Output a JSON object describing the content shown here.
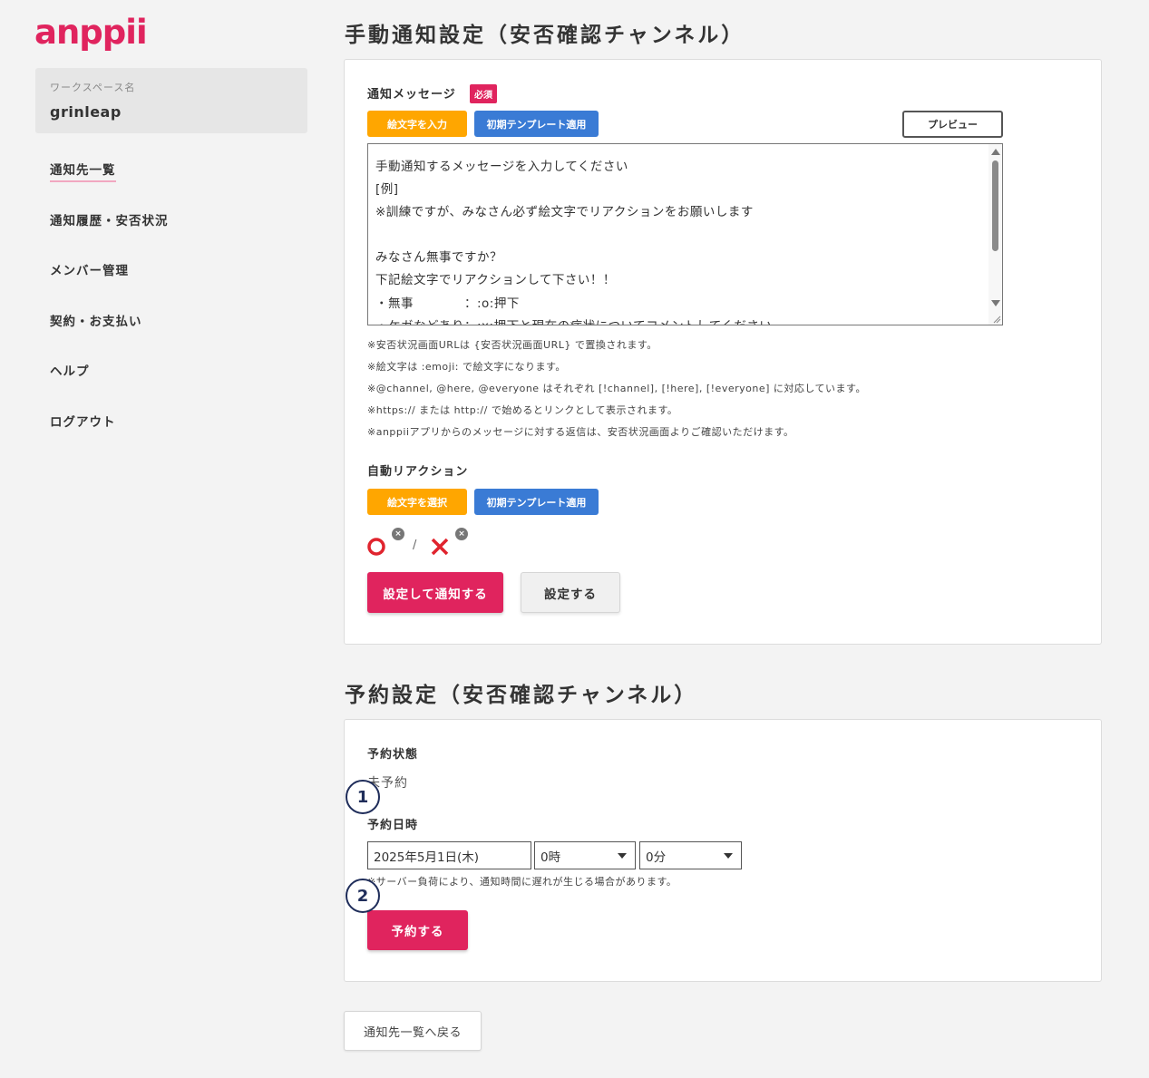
{
  "app": {
    "logo": "anppii",
    "brand_color": "#e0245e"
  },
  "workspace": {
    "label": "ワークスペース名",
    "name": "grinleap"
  },
  "nav": {
    "items": [
      {
        "label": "通知先一覧",
        "active": true
      },
      {
        "label": "通知履歴・安否状況"
      },
      {
        "label": "メンバー管理"
      },
      {
        "label": "契約・お支払い"
      },
      {
        "label": "ヘルプ"
      },
      {
        "label": "ログアウト"
      }
    ]
  },
  "manual": {
    "title": "手動通知設定（安否確認チャンネル）",
    "message_label": "通知メッセージ",
    "required_badge": "必須",
    "emoji_input_button": "絵文字を入力",
    "template_button": "初期テンプレート適用",
    "preview_button": "プレビュー",
    "message_lines": [
      "手動通知するメッセージを入力してください",
      "[例]",
      "※訓練ですが、みなさん必ず絵文字でリアクションをお願いします",
      "",
      "みなさん無事ですか？",
      "下記絵文字でリアクションして下さい！！",
      "・無事　　　　：:o:押下",
      "・ケガなどあり：:x:押下と現在の症状についてコメントしてください"
    ],
    "notes": [
      "※安否状況画面URLは {安否状況画面URL} で置換されます。",
      "※絵文字は :emoji: で絵文字になります。",
      "※@channel, @here, @everyone はそれぞれ [!channel], [!here], [!everyone] に対応しています。",
      "※https:// または http:// で始めるとリンクとして表示されます。",
      "※anppiiアプリからのメッセージに対する返信は、安否状況画面よりご確認いただけます。"
    ],
    "auto_reaction_label": "自動リアクション",
    "emoji_select_button": "絵文字を選択",
    "template_button_2": "初期テンプレート適用",
    "reactions": [
      "o",
      "x"
    ],
    "reaction_separator": "/",
    "set_and_notify_button": "設定して通知する",
    "set_button": "設定する"
  },
  "schedule": {
    "title": "予約設定（安否確認チャンネル）",
    "status_label": "予約状態",
    "status_value": "未予約",
    "datetime_label": "予約日時",
    "date_value": "2025年5月1日(木)",
    "hour_value": "0時",
    "minute_value": "0分",
    "note": "※サーバー負荷により、通知時間に遅れが生じる場合があります。",
    "reserve_button": "予約する"
  },
  "markers": [
    "1",
    "2"
  ],
  "back_button": "通知先一覧へ戻る"
}
